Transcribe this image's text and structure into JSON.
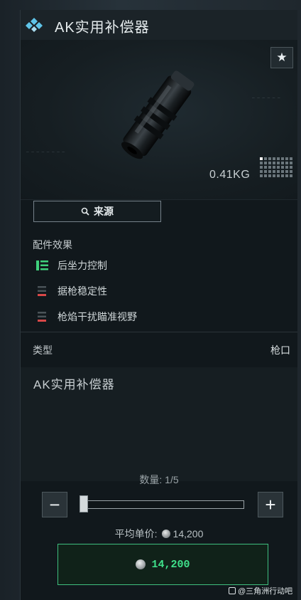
{
  "header": {
    "title": "AK实用补偿器"
  },
  "item": {
    "weight": "0.41KG",
    "source_label": "来源"
  },
  "effects": {
    "title": "配件效果",
    "items": [
      {
        "label": "后坐力控制",
        "polarity": "positive",
        "color": "#3fd07c",
        "icon": "bars-up-icon"
      },
      {
        "label": "据枪稳定性",
        "polarity": "negative",
        "color": "#d84848",
        "icon": "bars-down-icon"
      },
      {
        "label": "枪焰干扰瞄准视野",
        "polarity": "negative",
        "color": "#d84848",
        "icon": "bars-down-icon"
      }
    ]
  },
  "type_row": {
    "label": "类型",
    "value": "枪口"
  },
  "description": "AK实用补偿器",
  "purchase": {
    "qty_label": "数量: 1/5",
    "quantity": 1,
    "max_quantity": 5,
    "minus": "−",
    "plus": "+",
    "avg_label": "平均单价:",
    "avg_price": "14,200",
    "total_price": "14,200",
    "accent": "#3fe08a"
  },
  "watermark": "@三角洲行动吧"
}
